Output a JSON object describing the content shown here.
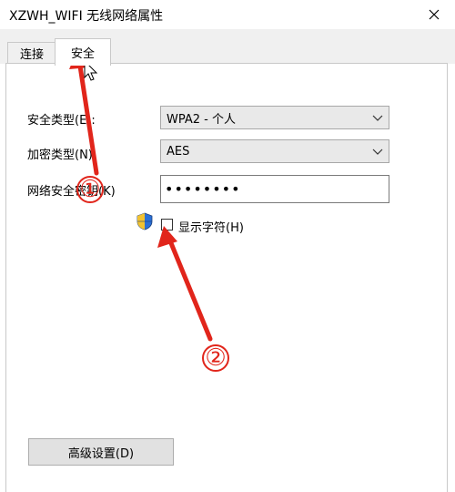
{
  "window": {
    "title": "XZWH_WIFI 无线网络属性"
  },
  "tabs": [
    {
      "label": "连接",
      "active": false
    },
    {
      "label": "安全",
      "active": true
    }
  ],
  "form": {
    "security_type_label": "安全类型(E):",
    "security_type_value": "WPA2 - 个人",
    "encryption_type_label": "加密类型(N):",
    "encryption_type_value": "AES",
    "network_key_label": "网络安全密钥(K)",
    "network_key_value": "••••••••",
    "show_chars_label": "显示字符(H)",
    "show_chars_checked": false
  },
  "advanced_button_label": "高级设置(D)",
  "annotations": {
    "marker_1": "①",
    "marker_2": "②"
  },
  "colors": {
    "accent_red": "#e1251b",
    "panel_bg": "#ffffff",
    "tab_bg": "#f0f0f0"
  }
}
